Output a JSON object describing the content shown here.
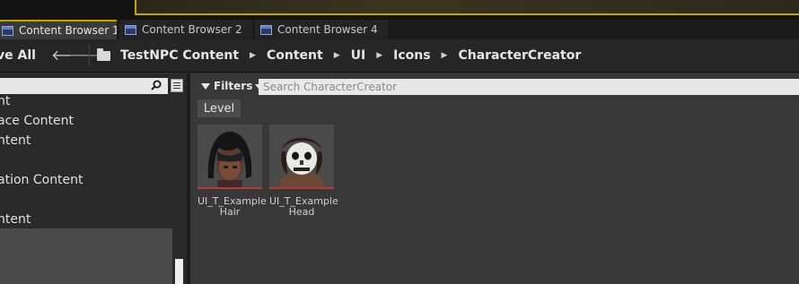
{
  "tabs": [
    {
      "label": "Content Browser 1",
      "active": true
    },
    {
      "label": "Content Browser 2",
      "active": false
    },
    {
      "label": "Content Browser 4",
      "active": false
    }
  ],
  "toolbar": {
    "save_all_label": "ve All",
    "back_glyph": "🡐",
    "forward_glyph": "🡒"
  },
  "breadcrumbs": [
    "TestNPC Content",
    "Content",
    "UI",
    "Icons",
    "CharacterCreator"
  ],
  "breadcrumb_separator": "▶",
  "sidebar": {
    "items": [
      "nt",
      "ace Content",
      "ntent",
      "ation Content",
      "ntent"
    ]
  },
  "content": {
    "filters_label": "Filters",
    "search_placeholder": "Search CharacterCreator",
    "level_chip": "Level",
    "assets": [
      {
        "name_line1": "UI_T_Example",
        "name_line2": "Hair",
        "icon": "hair-portrait"
      },
      {
        "name_line1": "UI_T_Example",
        "name_line2": "Head",
        "icon": "skull-head-portrait"
      }
    ]
  },
  "colors": {
    "accent": "#d0a000",
    "asset_type_bar": "#b23b3b"
  }
}
